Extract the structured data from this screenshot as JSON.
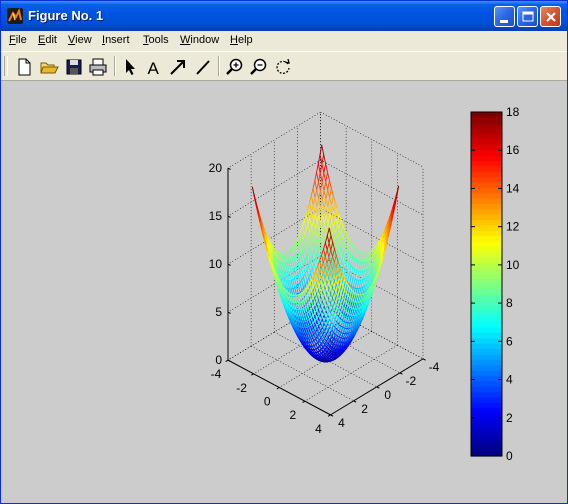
{
  "window": {
    "title": "Figure No. 1",
    "buttons": [
      "minimize",
      "maximize",
      "close"
    ]
  },
  "menu": {
    "items": [
      {
        "name": "file",
        "mnemonic": "F",
        "rest": "ile"
      },
      {
        "name": "edit",
        "mnemonic": "E",
        "rest": "dit"
      },
      {
        "name": "view",
        "mnemonic": "V",
        "rest": "iew"
      },
      {
        "name": "insert",
        "mnemonic": "I",
        "rest": "nsert"
      },
      {
        "name": "tools",
        "mnemonic": "T",
        "rest": "ools"
      },
      {
        "name": "window",
        "mnemonic": "W",
        "rest": "indow"
      },
      {
        "name": "help",
        "mnemonic": "H",
        "rest": "elp"
      }
    ]
  },
  "toolbar": {
    "tools": [
      "new-figure-icon",
      "open-folder-icon",
      "save-icon",
      "print-icon",
      "select-arrow-icon",
      "insert-text-icon",
      "insert-arrow-icon",
      "insert-line-icon",
      "zoom-in-icon",
      "zoom-out-icon",
      "rotate-3d-icon"
    ],
    "text_tool_glyph": "A"
  },
  "chart_data": {
    "type": "surface-mesh",
    "function": "z = x^2 + y^2",
    "x_range": [
      -3,
      3
    ],
    "y_range": [
      -3,
      3
    ],
    "mesh_step": 0.15,
    "z_range": [
      0,
      18
    ],
    "axes": {
      "x_limits": [
        -4,
        4
      ],
      "y_limits": [
        -4,
        4
      ],
      "z_limits": [
        0,
        20
      ],
      "x_ticks": [
        "-4",
        "-2",
        "0",
        "2",
        "4"
      ],
      "y_ticks": [
        "-4",
        "-2",
        "0",
        "2",
        "4"
      ],
      "z_ticks": [
        "0",
        "5",
        "10",
        "15",
        "20"
      ]
    },
    "grid": true,
    "colormap": "jet",
    "colorbar": {
      "limits": [
        0,
        18
      ],
      "ticks": [
        "0",
        "2",
        "4",
        "6",
        "8",
        "10",
        "12",
        "14",
        "16",
        "18"
      ],
      "placement": "right"
    },
    "colors": {
      "figure_background": "#cccccc",
      "axes_background": "#cccccc",
      "grid": "#000000"
    }
  }
}
